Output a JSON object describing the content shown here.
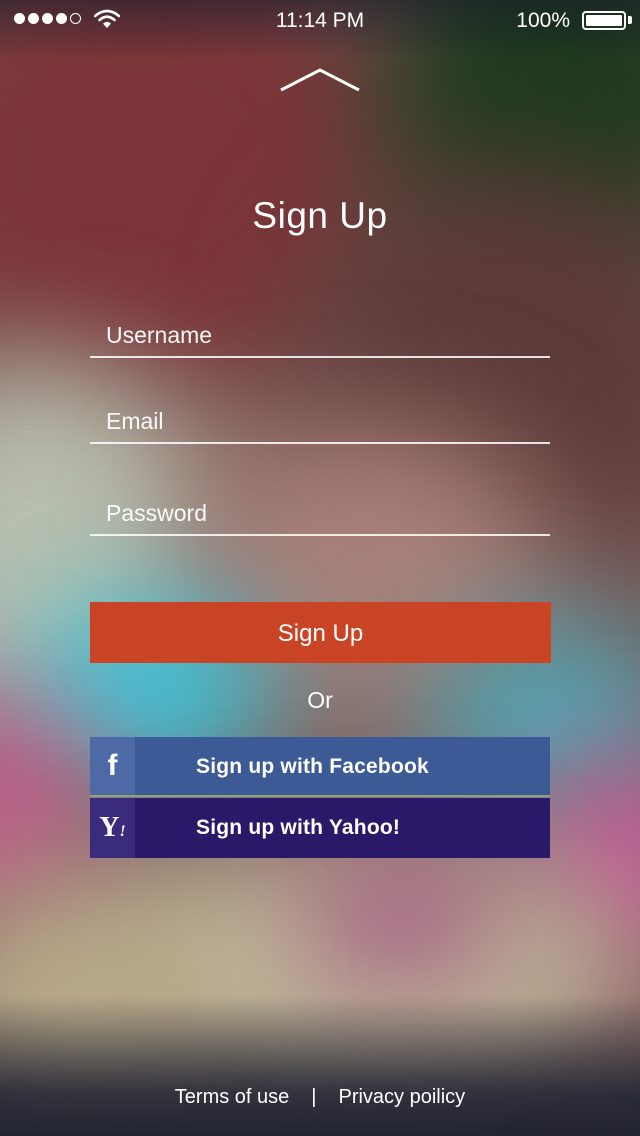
{
  "status_bar": {
    "time": "11:14 PM",
    "battery_percent": "100%",
    "signal_dots_filled": 4,
    "signal_dots_total": 5,
    "battery_level": 1.0
  },
  "header": {
    "collapse_icon": "chevron-up-icon",
    "title": "Sign Up"
  },
  "form": {
    "username_placeholder": "Username",
    "email_placeholder": "Email",
    "password_placeholder": "Password",
    "username_value": "",
    "email_value": "",
    "password_value": "",
    "submit_label": "Sign Up",
    "submit_color": "#c84425"
  },
  "divider": {
    "text": "Or"
  },
  "social": {
    "facebook": {
      "label": "Sign up with Facebook",
      "icon": "facebook-icon",
      "color": "#3b5a96"
    },
    "yahoo": {
      "label": "Sign up with Yahoo!",
      "icon": "yahoo-icon",
      "color": "#2a1868"
    }
  },
  "footer": {
    "terms": "Terms of use",
    "separator": "|",
    "privacy": "Privacy poilicy"
  }
}
